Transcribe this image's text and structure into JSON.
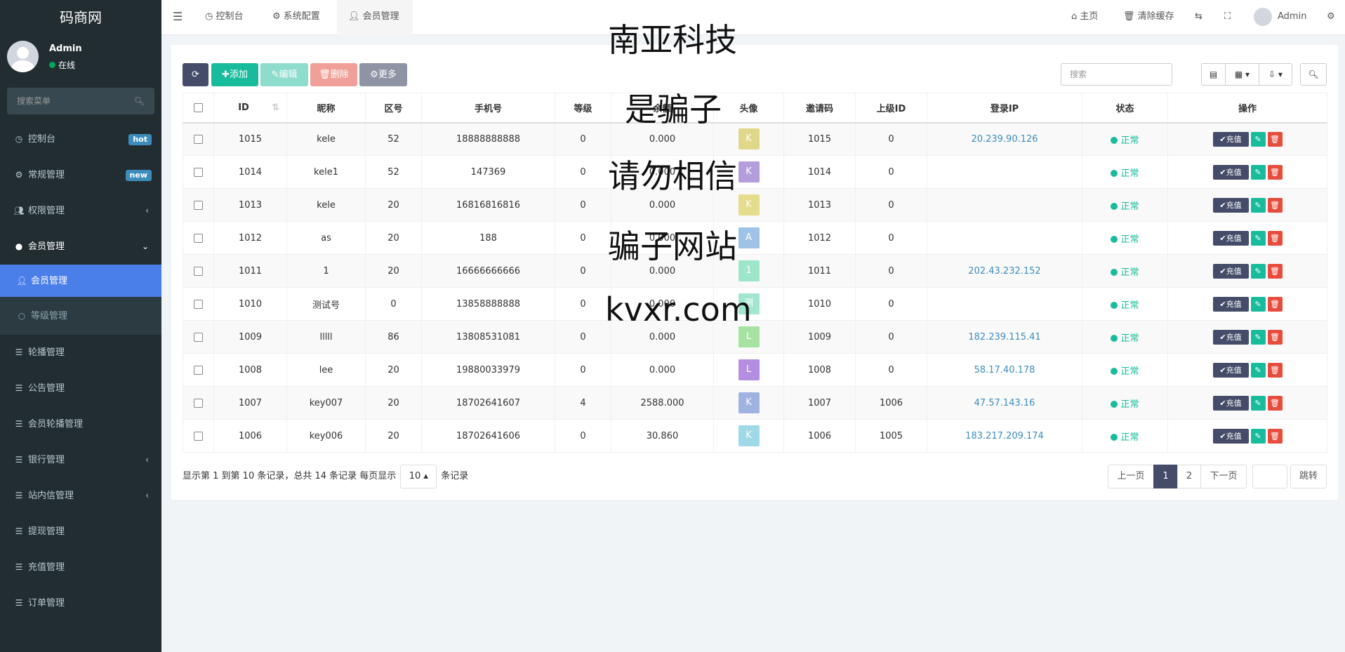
{
  "sidebar": {
    "logo": "码商网",
    "user_name": "Admin",
    "user_status": "在线",
    "search_placeholder": "搜索菜单",
    "items": [
      {
        "label": "控制台",
        "badge": "hot",
        "badge_color": "#3c8dbc"
      },
      {
        "label": "常规管理",
        "badge": "new",
        "badge_color": "#3c8dbc"
      },
      {
        "label": "权限管理",
        "chevron": "‹"
      },
      {
        "label": "会员管理",
        "chevron": "⌄"
      },
      {
        "label": "会员管理"
      },
      {
        "label": "等级管理"
      },
      {
        "label": "轮播管理"
      },
      {
        "label": "公告管理"
      },
      {
        "label": "会员轮播管理"
      },
      {
        "label": "银行管理",
        "chevron": "‹"
      },
      {
        "label": "站内信管理",
        "chevron": "‹"
      },
      {
        "label": "提现管理"
      },
      {
        "label": "充值管理"
      },
      {
        "label": "订单管理"
      }
    ]
  },
  "topbar": {
    "tabs": [
      "控制台",
      "系统配置",
      "会员管理"
    ],
    "home": "主页",
    "clear_cache": "清除缓存",
    "admin": "Admin"
  },
  "toolbar": {
    "add": "添加",
    "edit": "编辑",
    "delete": "删除",
    "more": "更多",
    "search_placeholder": "搜索"
  },
  "table": {
    "headers": [
      "ID",
      "昵称",
      "区号",
      "手机号",
      "等级",
      "余额",
      "头像",
      "邀请码",
      "上级ID",
      "登录IP",
      "状态",
      "操作"
    ],
    "rows": [
      {
        "id": "1015",
        "nick": "kele",
        "area": "52",
        "phone": "18888888888",
        "level": "0",
        "balance": "0.000",
        "avatar": "K",
        "avatar_color": "#e0d78a",
        "invite": "1015",
        "parent": "0",
        "ip": "20.239.90.126",
        "status": "正常"
      },
      {
        "id": "1014",
        "nick": "kele1",
        "area": "52",
        "phone": "147369",
        "level": "0",
        "balance": "0.000",
        "avatar": "K",
        "avatar_color": "#b39ddb",
        "invite": "1014",
        "parent": "0",
        "ip": "",
        "status": "正常"
      },
      {
        "id": "1013",
        "nick": "kele",
        "area": "20",
        "phone": "16816816816",
        "level": "0",
        "balance": "0.000",
        "avatar": "K",
        "avatar_color": "#e6dc8e",
        "invite": "1013",
        "parent": "0",
        "ip": "",
        "status": "正常"
      },
      {
        "id": "1012",
        "nick": "as",
        "area": "20",
        "phone": "188",
        "level": "0",
        "balance": "0.000",
        "avatar": "A",
        "avatar_color": "#9fc3e7",
        "invite": "1012",
        "parent": "0",
        "ip": "",
        "status": "正常"
      },
      {
        "id": "1011",
        "nick": "1",
        "area": "20",
        "phone": "16666666666",
        "level": "0",
        "balance": "0.000",
        "avatar": "1",
        "avatar_color": "#9ee6c9",
        "invite": "1011",
        "parent": "0",
        "ip": "202.43.232.152",
        "status": "正常"
      },
      {
        "id": "1010",
        "nick": "测试号",
        "area": "0",
        "phone": "13858888888",
        "level": "0",
        "balance": "0.000",
        "avatar": "测",
        "avatar_color": "#a3e6d0",
        "invite": "1010",
        "parent": "0",
        "ip": "",
        "status": "正常"
      },
      {
        "id": "1009",
        "nick": "lllll",
        "area": "86",
        "phone": "13808531081",
        "level": "0",
        "balance": "0.000",
        "avatar": "L",
        "avatar_color": "#a6e3a1",
        "invite": "1009",
        "parent": "0",
        "ip": "182.239.115.41",
        "status": "正常"
      },
      {
        "id": "1008",
        "nick": "lee",
        "area": "20",
        "phone": "19880033979",
        "level": "0",
        "balance": "0.000",
        "avatar": "L",
        "avatar_color": "#b48ee0",
        "invite": "1008",
        "parent": "0",
        "ip": "58.17.40.178",
        "status": "正常"
      },
      {
        "id": "1007",
        "nick": "key007",
        "area": "20",
        "phone": "18702641607",
        "level": "4",
        "balance": "2588.000",
        "avatar": "K",
        "avatar_color": "#9fb2e0",
        "invite": "1007",
        "parent": "1006",
        "ip": "47.57.143.16",
        "status": "正常"
      },
      {
        "id": "1006",
        "nick": "key006",
        "area": "20",
        "phone": "18702641606",
        "level": "0",
        "balance": "30.860",
        "avatar": "K",
        "avatar_color": "#9fd8e6",
        "invite": "1006",
        "parent": "1005",
        "ip": "183.217.209.174",
        "status": "正常"
      }
    ],
    "recharge_label": "充值"
  },
  "footer": {
    "info_prefix": "显示第 1 到第 10 条记录，总共 14 条记录 每页显示",
    "page_size": "10",
    "info_suffix": "条记录",
    "prev": "上一页",
    "page1": "1",
    "page2": "2",
    "next": "下一页",
    "jump": "跳转"
  },
  "watermark": [
    "南亚科技",
    "是骗子",
    "请勿相信",
    "骗子网站",
    "kvxr.com"
  ],
  "colors": {
    "sidebar": "#222d32",
    "accent": "#4a7ee8",
    "add": "#18bc9c",
    "delete": "#e74c3c",
    "dark": "#444c69"
  }
}
